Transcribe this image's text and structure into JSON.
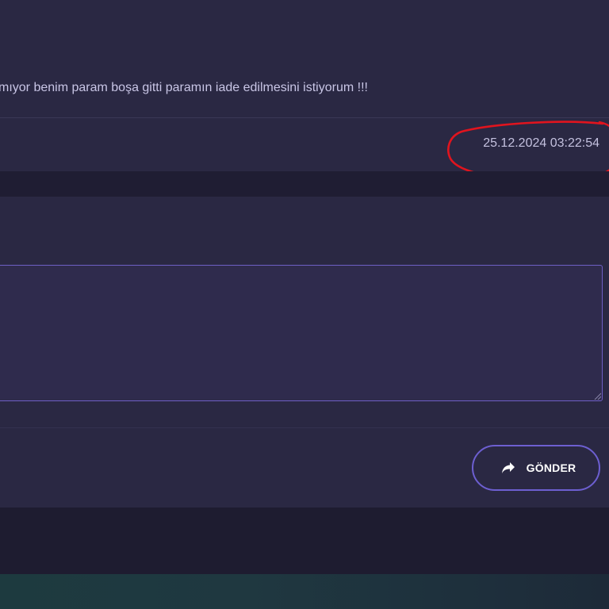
{
  "message": {
    "text": "mıyor benim param boşa gitti paramın iade edilmesini istiyorum !!!",
    "timestamp": "25.12.2024 03:22:54"
  },
  "reply": {
    "textarea_value": "",
    "send_label": "GÖNDER",
    "send_icon": "share-arrow-icon"
  },
  "colors": {
    "accent": "#6d5fd1",
    "annotation": "#e0141e"
  }
}
